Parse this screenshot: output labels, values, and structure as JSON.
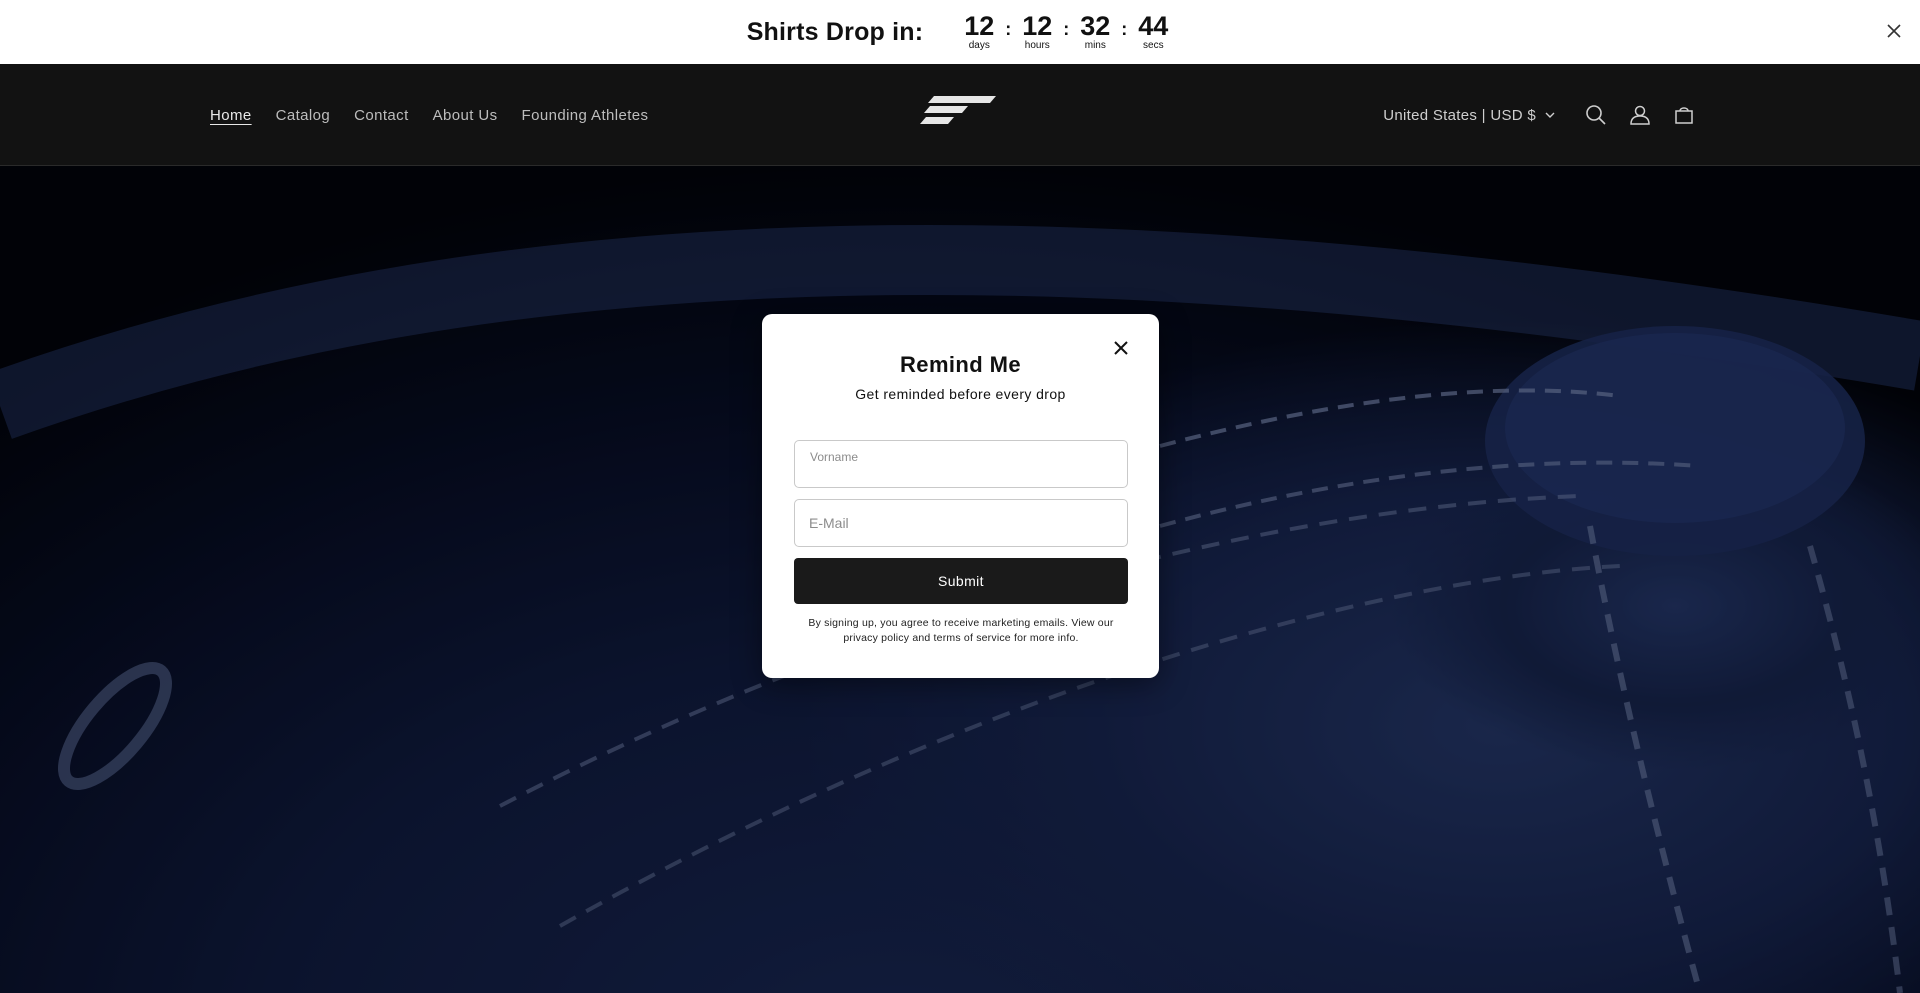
{
  "announcement": {
    "title": "Shirts Drop in:",
    "countdown": [
      {
        "value": "12",
        "label": "days"
      },
      {
        "value": "12",
        "label": "hours"
      },
      {
        "value": "32",
        "label": "mins"
      },
      {
        "value": "44",
        "label": "secs"
      }
    ],
    "separator": ":",
    "close_icon": "close-icon"
  },
  "header": {
    "nav": [
      {
        "label": "Home",
        "active": true
      },
      {
        "label": "Catalog",
        "active": false
      },
      {
        "label": "Contact",
        "active": false
      },
      {
        "label": "About Us",
        "active": false
      },
      {
        "label": "Founding Athletes",
        "active": false
      }
    ],
    "logo_icon": "brand-logo-icon",
    "currency": "United States | USD $",
    "icons": [
      "search-icon",
      "account-icon",
      "cart-icon"
    ]
  },
  "modal": {
    "title": "Remind Me",
    "subtitle": "Get reminded before every drop",
    "first_name_label": "Vorname",
    "first_name_value": "",
    "email_placeholder": "E-Mail",
    "email_value": "",
    "submit_label": "Submit",
    "legal_text": "By signing up, you agree to receive marketing emails. View our privacy policy and terms of service for more info.",
    "close_icon": "close-icon"
  },
  "colors": {
    "topbar_bg": "#ffffff",
    "header_bg": "#121212",
    "hero_navy": "#1c2d60",
    "button_bg": "#1a1a1a"
  }
}
